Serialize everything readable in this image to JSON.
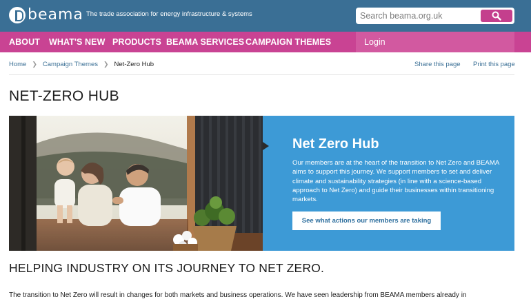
{
  "header": {
    "logo_text": "beama",
    "tagline": "The trade association for energy infrastructure & systems",
    "search": {
      "placeholder": "Search beama.org.uk",
      "icon": "search-icon"
    },
    "colors": {
      "header_bg": "#3a6f95",
      "nav_bg": "#c94393",
      "accent": "#c43f8d"
    }
  },
  "nav": {
    "items": [
      {
        "label": "ABOUT"
      },
      {
        "label": "WHAT'S NEW"
      },
      {
        "label": "PRODUCTS"
      },
      {
        "label": "BEAMA SERVICES"
      },
      {
        "label": "CAMPAIGN THEMES"
      }
    ],
    "login": "Login"
  },
  "breadcrumb": {
    "items": [
      "Home",
      "Campaign Themes",
      "Net-Zero Hub"
    ],
    "share": "Share this page",
    "print": "Print this page"
  },
  "page": {
    "title": "NET-ZERO HUB"
  },
  "hero": {
    "title": "Net Zero Hub",
    "text": "Our members are at the heart of the transition to Net Zero and BEAMA aims to support this journey. We support members to set and deliver climate and sustainability strategies (in line with a science-based approach to Net Zero) and guide their businesses within transitioning markets.",
    "cta": "See what actions our members are taking",
    "panel_color": "#3d9ad6"
  },
  "section": {
    "heading": "HELPING INDUSTRY ON ITS JOURNEY TO NET ZERO.",
    "intro": "The transition to Net Zero will result in changes for both markets and business operations. We have seen leadership from BEAMA members already in"
  }
}
